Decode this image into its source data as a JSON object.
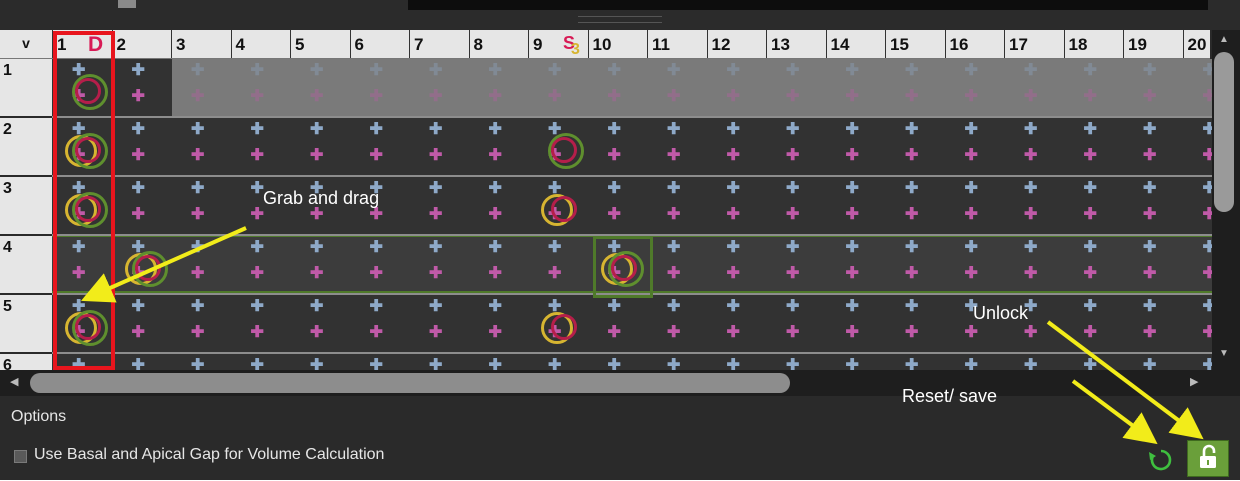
{
  "grid": {
    "corner_label": "v",
    "columns": [
      "1",
      "2",
      "3",
      "4",
      "5",
      "6",
      "7",
      "8",
      "9",
      "10",
      "11",
      "12",
      "13",
      "14",
      "15",
      "16",
      "17",
      "18",
      "19",
      "20"
    ],
    "rows": [
      "1",
      "2",
      "3",
      "4",
      "5",
      "6"
    ],
    "column_markers": {
      "d_label": "D",
      "s_label": "S",
      "s_sub": "3"
    }
  },
  "options": {
    "title": "Options",
    "checkbox_label": "Use Basal and Apical Gap for Volume Calculation",
    "checkbox_checked": false
  },
  "annotations": {
    "grab": "Grab and drag",
    "unlock": "Unlock",
    "reset": "Reset/ save"
  },
  "colors": {
    "highlight_box": "#e8151d",
    "arrow": "#f2ec1a",
    "ring_yellow": "#d7b531",
    "ring_green": "#5f8f2e",
    "ring_magenta": "#b51e4a",
    "plus_blue": "#8ea9c8",
    "plus_pink": "#c05aa8",
    "lock_button": "#6a9f3a"
  },
  "icons": [
    "reset-icon",
    "unlock-icon",
    "scroll-up-icon",
    "scroll-down-icon",
    "scroll-left-icon",
    "scroll-right-icon"
  ]
}
